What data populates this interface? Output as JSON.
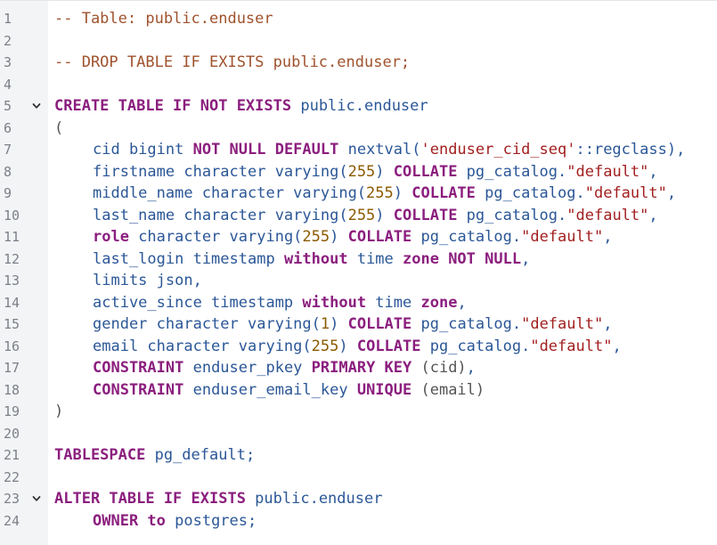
{
  "editor": {
    "colors": {
      "keyword": "#8b1e7e",
      "identifier": "#2b5797",
      "comment": "#a0522d",
      "string": "#a31f1f",
      "number": "#8b5a00",
      "punct": "#555555",
      "gutter_bg": "#f3f4f6",
      "line_number": "#7b8088"
    },
    "lines": [
      {
        "n": "1",
        "fold": false,
        "indent": 0,
        "tokens": [
          {
            "t": "comment",
            "v": "-- Table: public.enduser"
          }
        ]
      },
      {
        "n": "2",
        "fold": false,
        "indent": 0,
        "tokens": []
      },
      {
        "n": "3",
        "fold": false,
        "indent": 0,
        "tokens": [
          {
            "t": "comment",
            "v": "-- DROP TABLE IF EXISTS public.enduser;"
          }
        ]
      },
      {
        "n": "4",
        "fold": false,
        "indent": 0,
        "tokens": []
      },
      {
        "n": "5",
        "fold": true,
        "indent": 0,
        "tokens": [
          {
            "t": "keyword",
            "v": "CREATE TABLE IF NOT EXISTS"
          },
          {
            "t": "plain",
            "v": " public.enduser"
          }
        ]
      },
      {
        "n": "6",
        "fold": false,
        "indent": 0,
        "tokens": [
          {
            "t": "punct",
            "v": "("
          }
        ]
      },
      {
        "n": "7",
        "fold": false,
        "indent": 1,
        "tokens": [
          {
            "t": "plain",
            "v": "cid bigint "
          },
          {
            "t": "keyword",
            "v": "NOT NULL DEFAULT"
          },
          {
            "t": "plain",
            "v": " nextval("
          },
          {
            "t": "string",
            "v": "'enduser_cid_seq'"
          },
          {
            "t": "plain",
            "v": "::regclass),"
          }
        ]
      },
      {
        "n": "8",
        "fold": false,
        "indent": 1,
        "tokens": [
          {
            "t": "plain",
            "v": "firstname character varying("
          },
          {
            "t": "number",
            "v": "255"
          },
          {
            "t": "plain",
            "v": ") "
          },
          {
            "t": "keyword",
            "v": "COLLATE"
          },
          {
            "t": "plain",
            "v": " pg_catalog."
          },
          {
            "t": "string",
            "v": "\"default\""
          },
          {
            "t": "plain",
            "v": ","
          }
        ]
      },
      {
        "n": "9",
        "fold": false,
        "indent": 1,
        "tokens": [
          {
            "t": "plain",
            "v": "middle_name character varying("
          },
          {
            "t": "number",
            "v": "255"
          },
          {
            "t": "plain",
            "v": ") "
          },
          {
            "t": "keyword",
            "v": "COLLATE"
          },
          {
            "t": "plain",
            "v": " pg_catalog."
          },
          {
            "t": "string",
            "v": "\"default\""
          },
          {
            "t": "plain",
            "v": ","
          }
        ]
      },
      {
        "n": "10",
        "fold": false,
        "indent": 1,
        "tokens": [
          {
            "t": "plain",
            "v": "last_name character varying("
          },
          {
            "t": "number",
            "v": "255"
          },
          {
            "t": "plain",
            "v": ") "
          },
          {
            "t": "keyword",
            "v": "COLLATE"
          },
          {
            "t": "plain",
            "v": " pg_catalog."
          },
          {
            "t": "string",
            "v": "\"default\""
          },
          {
            "t": "plain",
            "v": ","
          }
        ]
      },
      {
        "n": "11",
        "fold": false,
        "indent": 1,
        "tokens": [
          {
            "t": "keyword",
            "v": "role"
          },
          {
            "t": "plain",
            "v": " character varying("
          },
          {
            "t": "number",
            "v": "255"
          },
          {
            "t": "plain",
            "v": ") "
          },
          {
            "t": "keyword",
            "v": "COLLATE"
          },
          {
            "t": "plain",
            "v": " pg_catalog."
          },
          {
            "t": "string",
            "v": "\"default\""
          },
          {
            "t": "plain",
            "v": ","
          }
        ]
      },
      {
        "n": "12",
        "fold": false,
        "indent": 1,
        "tokens": [
          {
            "t": "plain",
            "v": "last_login timestamp "
          },
          {
            "t": "keyword",
            "v": "without"
          },
          {
            "t": "plain",
            "v": " time "
          },
          {
            "t": "keyword",
            "v": "zone NOT NULL"
          },
          {
            "t": "plain",
            "v": ","
          }
        ]
      },
      {
        "n": "13",
        "fold": false,
        "indent": 1,
        "tokens": [
          {
            "t": "plain",
            "v": "limits json,"
          }
        ]
      },
      {
        "n": "14",
        "fold": false,
        "indent": 1,
        "tokens": [
          {
            "t": "plain",
            "v": "active_since timestamp "
          },
          {
            "t": "keyword",
            "v": "without"
          },
          {
            "t": "plain",
            "v": " time "
          },
          {
            "t": "keyword",
            "v": "zone"
          },
          {
            "t": "plain",
            "v": ","
          }
        ]
      },
      {
        "n": "15",
        "fold": false,
        "indent": 1,
        "tokens": [
          {
            "t": "plain",
            "v": "gender character varying("
          },
          {
            "t": "number",
            "v": "1"
          },
          {
            "t": "plain",
            "v": ") "
          },
          {
            "t": "keyword",
            "v": "COLLATE"
          },
          {
            "t": "plain",
            "v": " pg_catalog."
          },
          {
            "t": "string",
            "v": "\"default\""
          },
          {
            "t": "plain",
            "v": ","
          }
        ]
      },
      {
        "n": "16",
        "fold": false,
        "indent": 1,
        "tokens": [
          {
            "t": "plain",
            "v": "email character varying("
          },
          {
            "t": "number",
            "v": "255"
          },
          {
            "t": "plain",
            "v": ") "
          },
          {
            "t": "keyword",
            "v": "COLLATE"
          },
          {
            "t": "plain",
            "v": " pg_catalog."
          },
          {
            "t": "string",
            "v": "\"default\""
          },
          {
            "t": "plain",
            "v": ","
          }
        ]
      },
      {
        "n": "17",
        "fold": false,
        "indent": 1,
        "tokens": [
          {
            "t": "keyword",
            "v": "CONSTRAINT"
          },
          {
            "t": "plain",
            "v": " enduser_pkey "
          },
          {
            "t": "keyword",
            "v": "PRIMARY KEY"
          },
          {
            "t": "punct",
            "v": " (cid)"
          },
          {
            "t": "plain",
            "v": ","
          }
        ]
      },
      {
        "n": "18",
        "fold": false,
        "indent": 1,
        "tokens": [
          {
            "t": "keyword",
            "v": "CONSTRAINT"
          },
          {
            "t": "plain",
            "v": " enduser_email_key "
          },
          {
            "t": "keyword",
            "v": "UNIQUE"
          },
          {
            "t": "punct",
            "v": " (email)"
          }
        ]
      },
      {
        "n": "19",
        "fold": false,
        "indent": 0,
        "tokens": [
          {
            "t": "punct",
            "v": ")"
          }
        ]
      },
      {
        "n": "20",
        "fold": false,
        "indent": 0,
        "tokens": []
      },
      {
        "n": "21",
        "fold": false,
        "indent": 0,
        "tokens": [
          {
            "t": "keyword",
            "v": "TABLESPACE"
          },
          {
            "t": "plain",
            "v": " pg_default;"
          }
        ]
      },
      {
        "n": "22",
        "fold": false,
        "indent": 0,
        "tokens": []
      },
      {
        "n": "23",
        "fold": true,
        "indent": 0,
        "tokens": [
          {
            "t": "keyword",
            "v": "ALTER TABLE IF EXISTS"
          },
          {
            "t": "plain",
            "v": " public.enduser"
          }
        ]
      },
      {
        "n": "24",
        "fold": false,
        "indent": 1,
        "tokens": [
          {
            "t": "keyword",
            "v": "OWNER to"
          },
          {
            "t": "plain",
            "v": " postgres;"
          }
        ]
      }
    ]
  }
}
